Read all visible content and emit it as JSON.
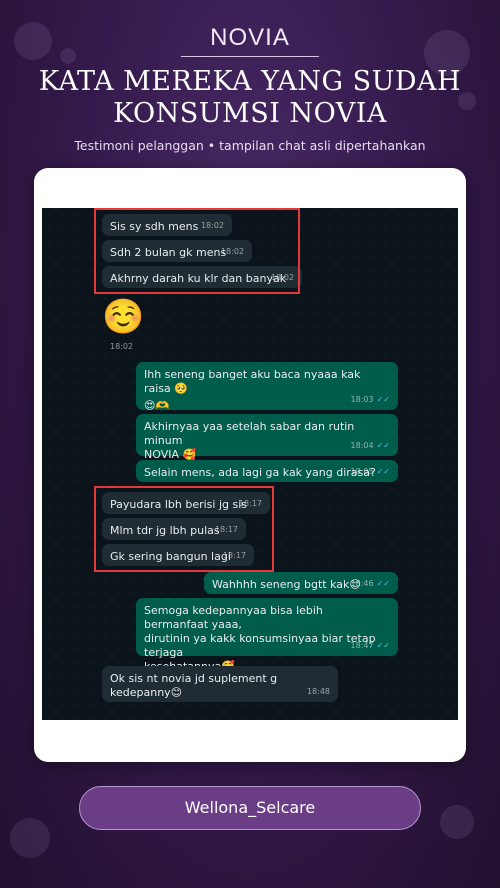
{
  "header": {
    "brand": "NOVIA",
    "headline_line1": "KATA MEREKA YANG SUDAH",
    "headline_line2": "KONSUMSI NOVIA",
    "subtitle": "Testimoni pelanggan • tampilan chat asli dipertahankan"
  },
  "chat": {
    "messages": [
      {
        "text": "Sis sy sdh mens",
        "time": "18:02"
      },
      {
        "text": "Sdh 2 bulan gk mens",
        "time": "18:02"
      },
      {
        "text": "Akhrny darah ku klr dan banyak",
        "time": "18:02"
      },
      {
        "text": "☺️",
        "time": "18:02"
      },
      {
        "text": "Ihh seneng banget aku baca nyaaa kak raisa 🥺",
        "text2": "😍🫶",
        "time": "18:03"
      },
      {
        "text": "Akhirnyaa yaa setelah sabar dan rutin minum",
        "text2": "NOVIA 🥰",
        "time": "18:04"
      },
      {
        "text": "Selain mens, ada lagi ga kak yang dirasa?",
        "time": "18:05"
      },
      {
        "text": "Payudara lbh berisi jg sis",
        "time": "18:17"
      },
      {
        "text": "Mlm tdr jg lbh pulas",
        "time": "18:17"
      },
      {
        "text": "Gk sering bangun lagi",
        "time": "18:17"
      },
      {
        "text": "Wahhhh seneng bgtt kak😊",
        "time": "18:46"
      },
      {
        "text": "Semoga kedepannyaa bisa lebih bermanfaat yaaa,",
        "text2": "dirutinin ya kakk konsumsinyaa biar tetap terjaga",
        "text3": "kesehatannya🥰",
        "time": "18:47"
      },
      {
        "text": "Ok sis nt novia jd suplement g kedepanny😊",
        "time": "18:48"
      }
    ],
    "highlight_color": "#e23a3a"
  },
  "footer": {
    "handle": "Wellona_Selcare"
  },
  "colors": {
    "background": "#351b4e",
    "incoming_bubble": "#202c33",
    "outgoing_bubble": "#005c4b",
    "read_tick": "#53bdeb"
  },
  "icons": {
    "read_receipt": "double-check-icon"
  }
}
